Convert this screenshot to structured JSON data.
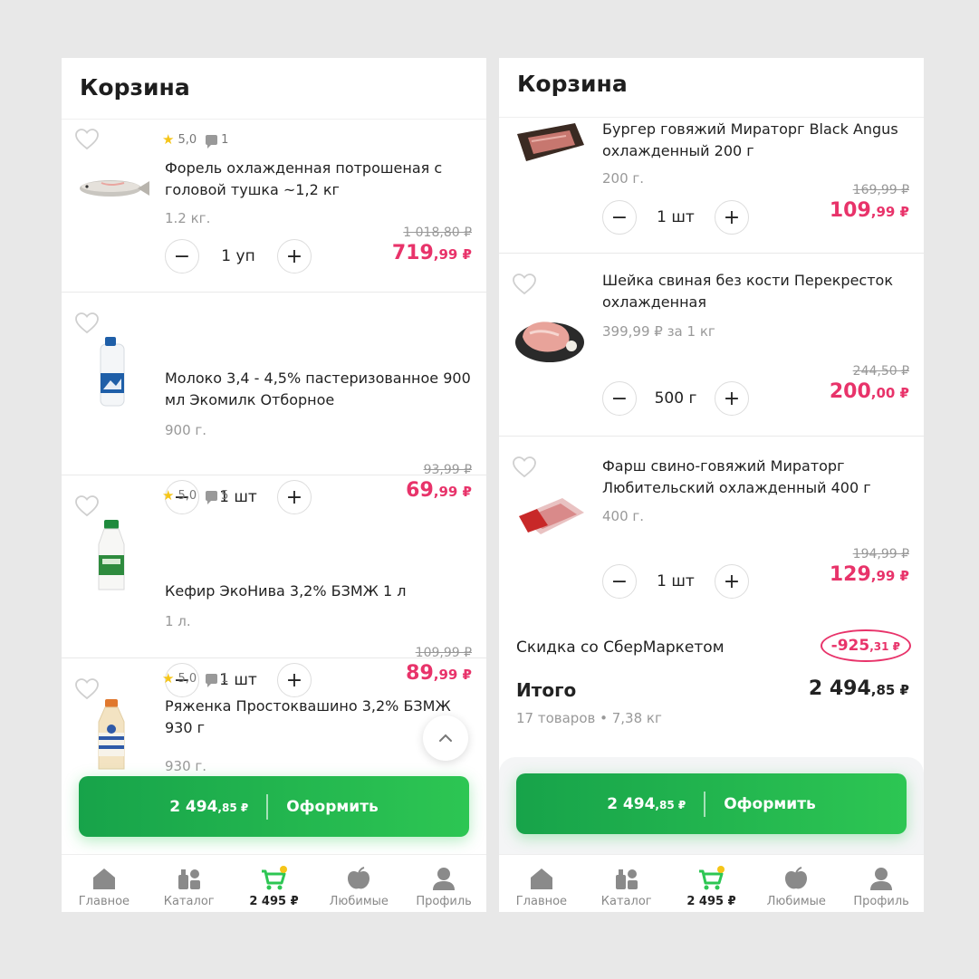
{
  "left": {
    "header_title": "Корзина",
    "items": [
      {
        "rating": "5,0",
        "comments": "1",
        "title": "Форель охлажденная потрошеная с головой тушка ~1,2 кг",
        "weight": "1.2 кг.",
        "qty": "1 уп",
        "old_price": "1 018,80 ₽",
        "price_rub": "719",
        "price_kop": ",99 ₽"
      },
      {
        "rating": "",
        "comments": "",
        "title": "Молоко 3,4 - 4,5% пастеризованное 900 мл Экомилк Отборное",
        "weight": "900 г.",
        "qty": "1 шт",
        "old_price": "93,99 ₽",
        "price_rub": "69",
        "price_kop": ",99 ₽"
      },
      {
        "rating": "5,0",
        "comments": "5",
        "title": "Кефир ЭкоНива 3,2% БЗМЖ 1 л",
        "weight": "1 л.",
        "qty": "1 шт",
        "old_price": "109,99 ₽",
        "price_rub": "89",
        "price_kop": ",99 ₽"
      },
      {
        "rating": "5,0",
        "comments": "1",
        "title": "Ряженка Простоквашино 3,2% БЗМЖ 930 г",
        "weight": "930 г.",
        "qty": "",
        "old_price": "",
        "price_rub": "",
        "price_kop": ""
      }
    ],
    "checkout": {
      "amount_rub": "2 494",
      "amount_kop": ",85 ₽",
      "label": "Оформить"
    },
    "tabs": [
      {
        "label": "Главное",
        "icon": "home-icon"
      },
      {
        "label": "Каталог",
        "icon": "catalog-icon"
      },
      {
        "label": "2 495 ₽",
        "icon": "cart-icon"
      },
      {
        "label": "Любимые",
        "icon": "apple-icon"
      },
      {
        "label": "Профиль",
        "icon": "profile-icon"
      }
    ]
  },
  "right": {
    "header_title": "Корзина",
    "items": [
      {
        "title": "Бургер говяжий Мираторг Black Angus охлажденный 200 г",
        "weight": "200 г.",
        "qty": "1 шт",
        "old_price": "169,99 ₽",
        "price_rub": "109",
        "price_kop": ",99 ₽"
      },
      {
        "title": "Шейка свиная без кости Перекресток охлажденная",
        "weight": "399,99 ₽ за 1 кг",
        "qty": "500 г",
        "old_price": "244,50 ₽",
        "price_rub": "200",
        "price_kop": ",00 ₽"
      },
      {
        "title": "Фарш свино-говяжий Мираторг Любительский охлажденный 400 г",
        "weight": "400 г.",
        "qty": "1 шт",
        "old_price": "194,99 ₽",
        "price_rub": "129",
        "price_kop": ",99 ₽"
      }
    ],
    "discount": {
      "label": "Скидка со СберМаркетом",
      "value_rub": "-925",
      "value_kop": ",31 ₽"
    },
    "total": {
      "label": "Итого",
      "value_rub": "2 494",
      "value_kop": ",85 ₽",
      "sub": "17 товаров • 7,38 кг"
    },
    "checkout": {
      "amount_rub": "2 494",
      "amount_kop": ",85 ₽",
      "label": "Оформить"
    },
    "tabs": [
      {
        "label": "Главное",
        "icon": "home-icon"
      },
      {
        "label": "Каталог",
        "icon": "catalog-icon"
      },
      {
        "label": "2 495 ₽",
        "icon": "cart-icon"
      },
      {
        "label": "Любимые",
        "icon": "apple-icon"
      },
      {
        "label": "Профиль",
        "icon": "profile-icon"
      }
    ]
  },
  "colors": {
    "accent_green": "#2dc653",
    "price_pink": "#e8336a",
    "background": "#e8e8e8"
  }
}
